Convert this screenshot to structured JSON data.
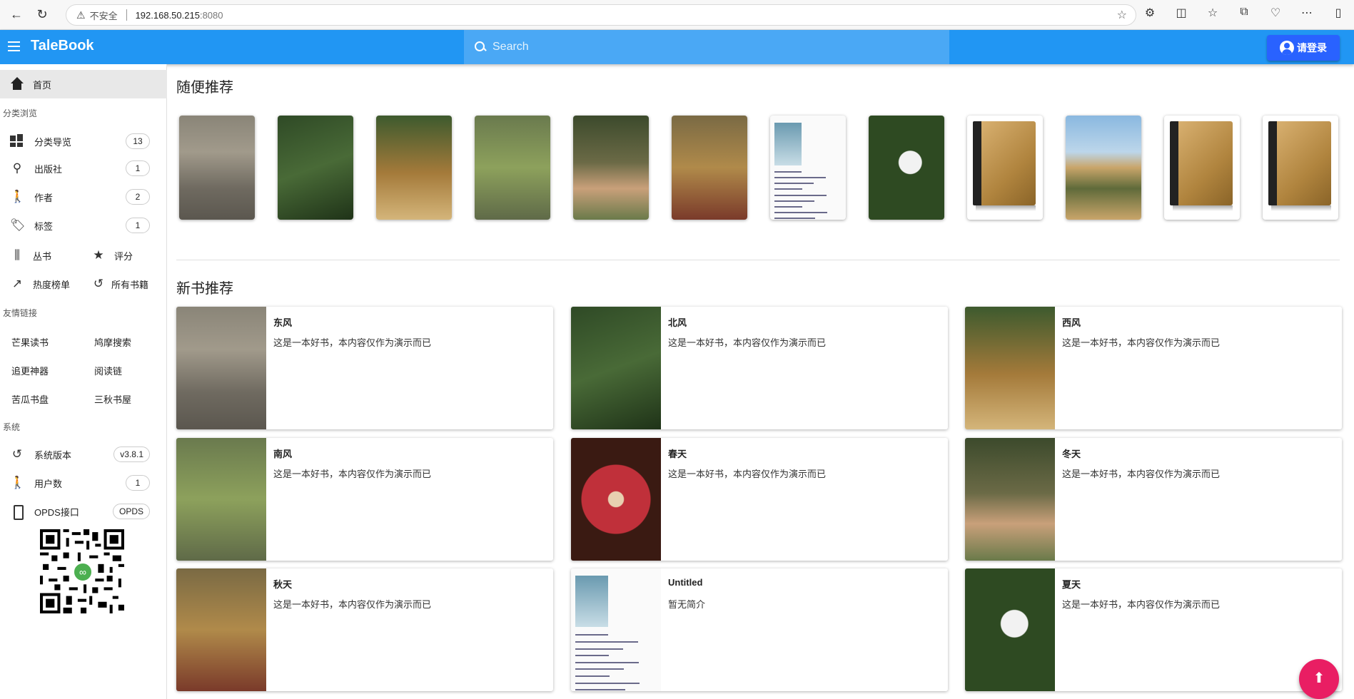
{
  "browser": {
    "insecure_label": "不安全",
    "host": "192.168.50.215",
    "port": ":8080"
  },
  "app": {
    "brand": "TaleBook",
    "search_placeholder": "Search",
    "login_label": "请登录",
    "accent": "#2196f3"
  },
  "sidebar": {
    "home": "首页",
    "browse_title": "分类浏览",
    "browse": [
      {
        "label": "分类导览",
        "count": "13",
        "icon": "grid-icon"
      },
      {
        "label": "出版社",
        "count": "1",
        "icon": "tree-icon"
      },
      {
        "label": "作者",
        "count": "2",
        "icon": "person-icon"
      },
      {
        "label": "标签",
        "count": "1",
        "icon": "tag-icon"
      }
    ],
    "series": "丛书",
    "rating": "评分",
    "hot": "热度榜单",
    "all_books": "所有书籍",
    "links_title": "友情链接",
    "links": [
      "芒果读书",
      "鸠摩搜索",
      "追更神器",
      "阅读链",
      "苦瓜书盘",
      "三秋书屋"
    ],
    "system_title": "系统",
    "system": [
      {
        "label": "系统版本",
        "value": "v3.8.1"
      },
      {
        "label": "用户数",
        "value": "1"
      },
      {
        "label": "OPDS接口",
        "value": "OPDS"
      }
    ]
  },
  "main": {
    "random_title": "随便推荐",
    "random_covers": [
      "panda",
      "hornbill",
      "lorikeet",
      "kakapo",
      "deer",
      "lion",
      "doc",
      "flower",
      "book",
      "desert",
      "book",
      "book"
    ],
    "new_title": "新书推荐",
    "new_books": [
      {
        "title": "东风",
        "desc": "这是一本好书，本内容仅作为演示而已",
        "cover": "panda"
      },
      {
        "title": "北风",
        "desc": "这是一本好书，本内容仅作为演示而已",
        "cover": "hornbill"
      },
      {
        "title": "西风",
        "desc": "这是一本好书，本内容仅作为演示而已",
        "cover": "lorikeet"
      },
      {
        "title": "南风",
        "desc": "这是一本好书，本内容仅作为演示而已",
        "cover": "kakapo"
      },
      {
        "title": "春天",
        "desc": "这是一本好书，本内容仅作为演示而已",
        "cover": "drosera"
      },
      {
        "title": "冬天",
        "desc": "这是一本好书，本内容仅作为演示而已",
        "cover": "deer"
      },
      {
        "title": "秋天",
        "desc": "这是一本好书，本内容仅作为演示而已",
        "cover": "lion"
      },
      {
        "title": "Untitled",
        "desc": "暂无简介",
        "cover": "doc"
      },
      {
        "title": "夏天",
        "desc": "这是一本好书，本内容仅作为演示而已",
        "cover": "flower"
      }
    ]
  },
  "fab_color": "#e91e63"
}
